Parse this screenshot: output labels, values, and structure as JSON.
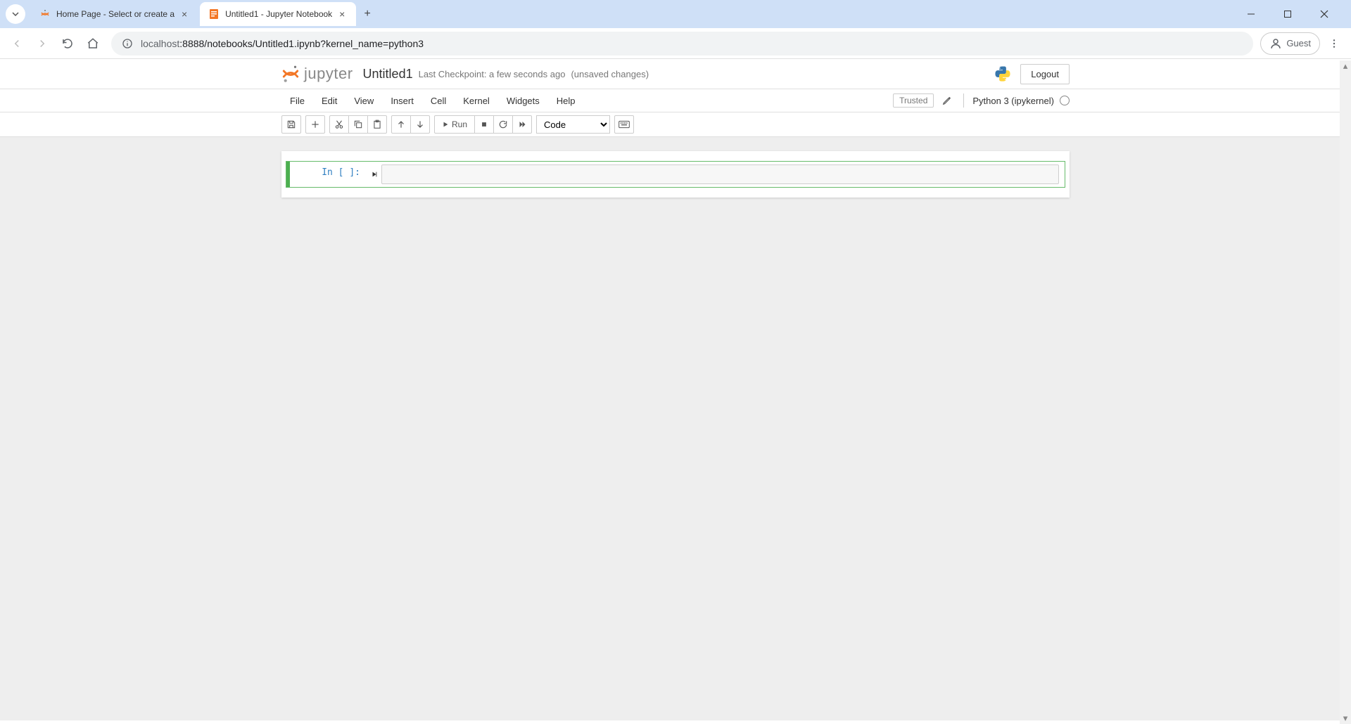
{
  "browser": {
    "tabs": [
      {
        "title": "Home Page - Select or create a",
        "active": false
      },
      {
        "title": "Untitled1 - Jupyter Notebook",
        "active": true
      }
    ],
    "url_host": "localhost",
    "url_path": ":8888/notebooks/Untitled1.ipynb?kernel_name=python3",
    "guest_label": "Guest"
  },
  "header": {
    "logo_text": "jupyter",
    "notebook_name": "Untitled1",
    "checkpoint": "Last Checkpoint: a few seconds ago",
    "unsaved": "(unsaved changes)",
    "logout": "Logout"
  },
  "menubar": {
    "items": [
      "File",
      "Edit",
      "View",
      "Insert",
      "Cell",
      "Kernel",
      "Widgets",
      "Help"
    ],
    "trusted": "Trusted",
    "kernel": "Python 3 (ipykernel)"
  },
  "toolbar": {
    "run_label": "Run",
    "cell_type": "Code"
  },
  "cell": {
    "prompt": "In [ ]:",
    "content": ""
  }
}
